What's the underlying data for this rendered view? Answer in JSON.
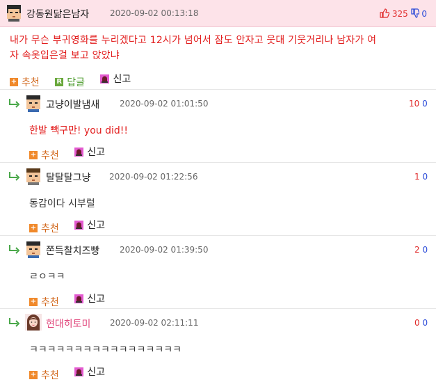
{
  "post": {
    "author": "강동원닮은남자",
    "timestamp": "2020-09-02 00:13:18",
    "upvotes": "325",
    "downvotes": "0",
    "body_line1": "내가 무슨 부귀영화를 누리겠다고 12시가 넘어서 잠도 안자고 웃대 기웃거리나 남자가 여",
    "body_line2": "자 속옷입은걸 보고 앉았냐",
    "recommend_label": "추천",
    "reply_label": "답글",
    "report_label": "신고"
  },
  "comments": [
    {
      "author": "고냥이발냄새",
      "timestamp": "2020-09-02 01:01:50",
      "upvotes": "10",
      "downvotes": "0",
      "text": "한발 빽구만! you did!!",
      "recommend_label": "추천",
      "report_label": "신고"
    },
    {
      "author": "탈탈탈그냥",
      "timestamp": "2020-09-02 01:22:56",
      "upvotes": "1",
      "downvotes": "0",
      "text": "동감이다 시부럴",
      "recommend_label": "추천",
      "report_label": "신고"
    },
    {
      "author": "쫀득찰치즈빵",
      "timestamp": "2020-09-02 01:39:50",
      "upvotes": "2",
      "downvotes": "0",
      "text": "ㄹㅇㅋㅋ",
      "recommend_label": "추천",
      "report_label": "신고"
    },
    {
      "author": "현대히토미",
      "timestamp": "2020-09-02 02:11:11",
      "upvotes": "0",
      "downvotes": "0",
      "text": "ㅋㅋㅋㅋㅋㅋㅋㅋㅋㅋㅋㅋㅋㅋㅋㅋㅋ",
      "recommend_label": "추천",
      "report_label": "신고"
    }
  ],
  "colors": {
    "header_bg": "#fde3e9",
    "upvote": "#e02a2a",
    "downvote": "#2a4ad8",
    "post_text": "#e21e1e",
    "recommend": "#d2691e",
    "reply": "#4a9a2a",
    "pink_name": "#e0457a"
  },
  "icons": [
    "pixel-avatar-icon",
    "thumbs-up-icon",
    "thumbs-down-icon",
    "plus-icon",
    "reply-r-icon",
    "report-siren-icon",
    "reply-arrow-icon",
    "girl-avatar-icon"
  ]
}
